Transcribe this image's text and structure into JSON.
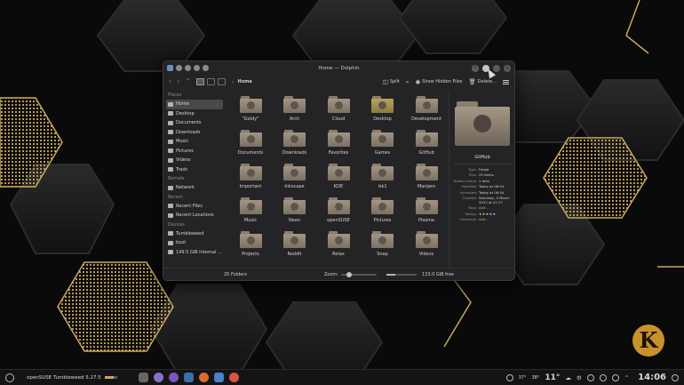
{
  "window": {
    "title": "Home — Dolphin",
    "breadcrumb": "Home",
    "toolbar": {
      "split": "Split",
      "show_hidden": "Show Hidden Files",
      "delete": "Delete..."
    }
  },
  "sidebar": {
    "sections": [
      {
        "title": "Places",
        "items": [
          "Home",
          "Desktop",
          "Documents",
          "Downloads",
          "Music",
          "Pictures",
          "Videos",
          "Trash"
        ]
      },
      {
        "title": "Remote",
        "items": [
          "Network"
        ]
      },
      {
        "title": "Recent",
        "items": [
          "Recent Files",
          "Recent Locations"
        ]
      },
      {
        "title": "Devices",
        "items": [
          "Tumbleweed",
          "boot",
          "149.5 GiB Internal ..."
        ]
      }
    ]
  },
  "folders": [
    "\"Goldy\"",
    "Arch",
    "Cloud",
    "Desktop",
    "Development",
    "Documents",
    "Downloads",
    "Favorites",
    "Games",
    "GitHub",
    "Important",
    "Inkscape",
    "KDE",
    "lsk1",
    "Manjaro",
    "Music",
    "Neon",
    "openSUSE",
    "Pictures",
    "Plasma",
    "Projects",
    "Reddit",
    "Relax",
    "Snap",
    "Videos"
  ],
  "info_panel": {
    "name": "GitHub",
    "rows": [
      {
        "k": "Type:",
        "v": "Folder"
      },
      {
        "k": "Size:",
        "v": "25 items"
      },
      {
        "k": "Hidden items:",
        "v": "1 item"
      },
      {
        "k": "Modified:",
        "v": "Today at 08:54"
      },
      {
        "k": "Accessed:",
        "v": "Today at 08:54"
      },
      {
        "k": "Created:",
        "v": "Saturday, 4 March 2023 at 21:17"
      },
      {
        "k": "Tags:",
        "v": "Add..."
      },
      {
        "k": "Rating:",
        "v": "★★★★★"
      },
      {
        "k": "Comment:",
        "v": "Add..."
      }
    ]
  },
  "status": {
    "folders": "25 Folders",
    "zoom_label": "Zoom:",
    "free": "133.0 GiB free"
  },
  "taskbar": {
    "os": "openSUSE Tumbleweed 5.27.5",
    "temps": [
      "37°",
      "38°"
    ],
    "weather": "11°",
    "clock": "14:06"
  },
  "colors": {
    "accent": "#c9a85a",
    "window_bg": "#242426"
  }
}
